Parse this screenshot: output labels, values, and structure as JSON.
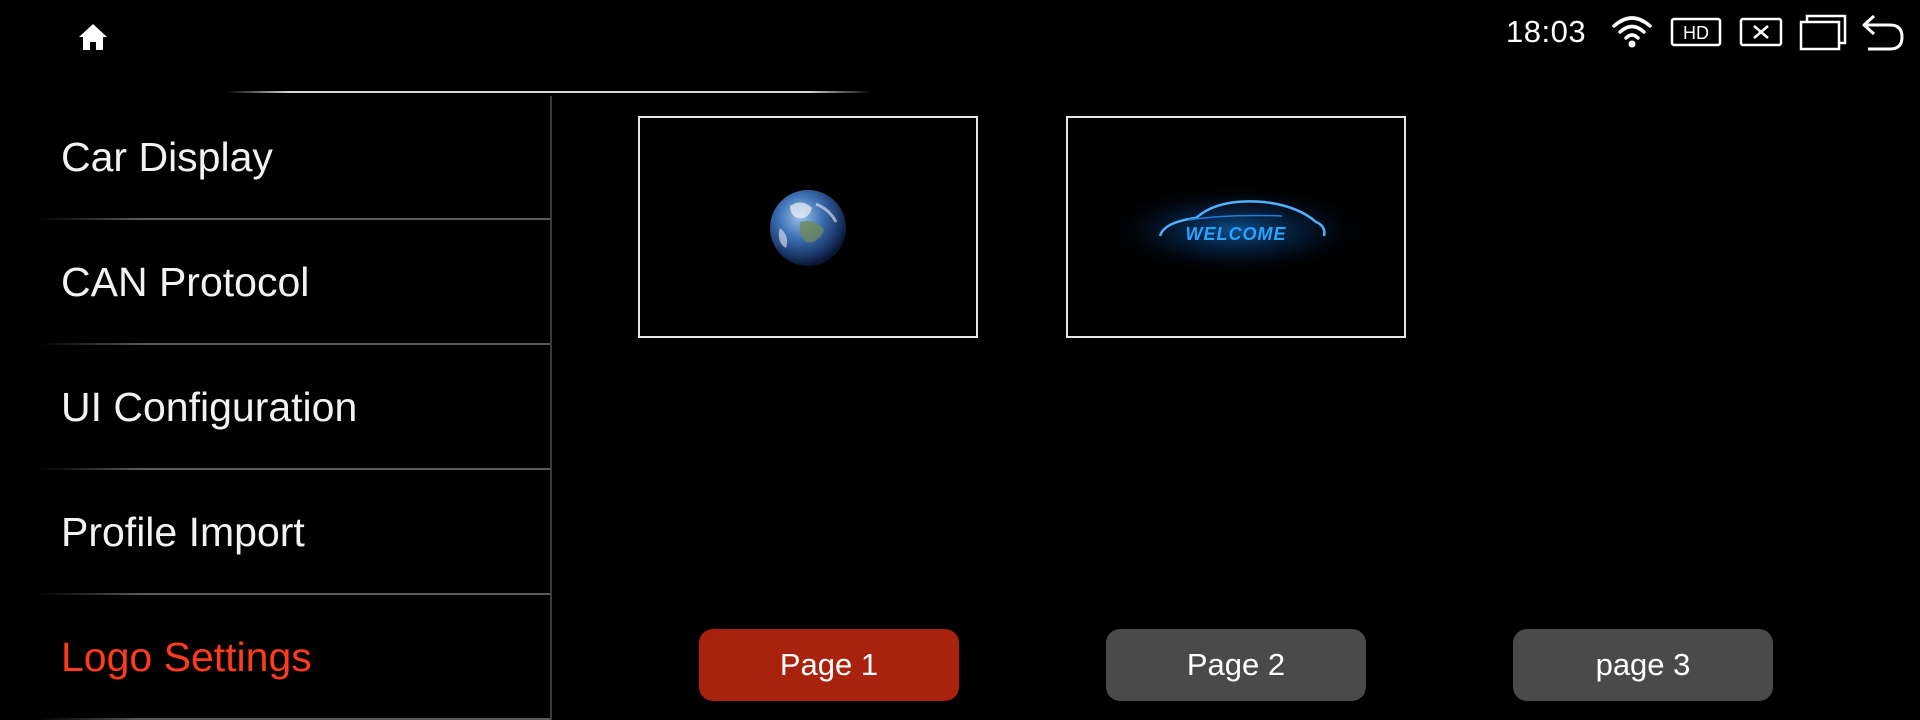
{
  "status_bar": {
    "time": "18:03",
    "hd_label": "HD",
    "icons": [
      "home-icon",
      "wifi-icon",
      "hd-icon",
      "close-box-icon",
      "window-icon",
      "back-arrow-icon"
    ]
  },
  "sidebar": {
    "items": [
      {
        "label": "Car Display",
        "active": false
      },
      {
        "label": "CAN Protocol",
        "active": false
      },
      {
        "label": "UI Configuration",
        "active": false
      },
      {
        "label": "Profile Import",
        "active": false
      },
      {
        "label": "Logo Settings",
        "active": true
      }
    ],
    "active_color": "#ff3b1a"
  },
  "logos": {
    "tiles": [
      {
        "name": "earth-logo"
      },
      {
        "name": "welcome-car-logo",
        "text": "WELCOME"
      }
    ]
  },
  "pagination": {
    "buttons": [
      {
        "label": "Page 1",
        "active": true
      },
      {
        "label": "Page 2",
        "active": false
      },
      {
        "label": "page 3",
        "active": false
      }
    ],
    "active_color": "#a8220e",
    "inactive_color": "#4a4a4a"
  }
}
